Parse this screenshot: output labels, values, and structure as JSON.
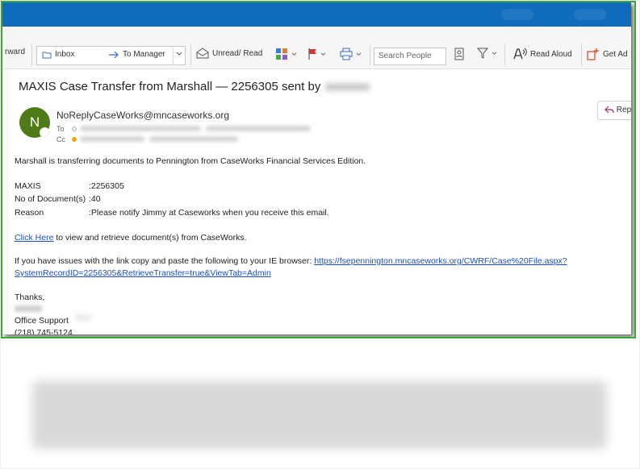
{
  "ribbon": {
    "forward_label": "rward",
    "quick_steps": {
      "inbox_label": "Inbox",
      "to_manager_label": "To Manager"
    },
    "unread_read_label": "Unread/ Read",
    "search_people_placeholder": "Search People",
    "read_aloud_label": "Read Aloud",
    "get_addins_label": "Get Ad"
  },
  "message": {
    "subject": "MAXIS Case Transfer from Marshall — 2256305 sent by",
    "sender_initial": "N",
    "sender_email": "NoReplyCaseWorks@mncaseworks.org",
    "to_label": "To",
    "cc_label": "Cc",
    "reply_label": "Rep"
  },
  "body": {
    "intro": "Marshall is transferring documents to Pennington from CaseWorks Financial Services Edition.",
    "fields": [
      {
        "key": "MAXIS",
        "value": ":2256305"
      },
      {
        "key": "No of Document(s)",
        "value": ":40"
      },
      {
        "key": "Reason",
        "value": ":Please notify Jimmy at Caseworks when you receive this email."
      }
    ],
    "click_here": "Click Here",
    "click_here_rest": " to view and retrieve document(s) from CaseWorks.",
    "issues_text": "If you have issues with the link copy and paste the following to your IE browser: ",
    "link_part1": "https://fsepennington.mncaseworks.org/CWRF/Case%20File.aspx?",
    "link_part2": "SystemRecordID=2256305&RetrieveTransfer=true&ViewTab=Admin",
    "thanks": "Thanks,",
    "office": "Office Support",
    "phone": "(218) 745-5124"
  },
  "colors": {
    "titlebar": "#0f6cbd",
    "avatar": "#4e7a18",
    "link": "#1a4fc4",
    "frame": "#3aa832"
  }
}
